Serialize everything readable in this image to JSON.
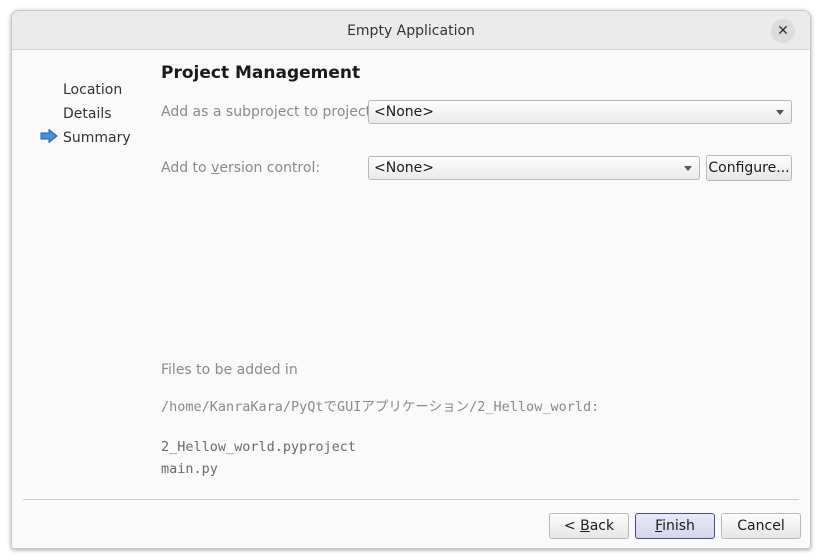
{
  "window": {
    "title": "Empty Application",
    "close_glyph": "✕"
  },
  "steps": [
    {
      "label": "Location",
      "current": false
    },
    {
      "label": "Details",
      "current": false
    },
    {
      "label": "Summary",
      "current": true
    }
  ],
  "page": {
    "title": "Project Management",
    "subproject_label": "Add as a subproject to project:",
    "subproject_value": "<None>",
    "vcs_label_pre": "Add to ",
    "vcs_label_mnemonic": "v",
    "vcs_label_post": "ersion control:",
    "vcs_value": "<None>",
    "configure_label": "Configure...",
    "files_heading": "Files to be added in",
    "files_path": "/home/KanraKara/PyQtでGUIアプリケーション/2_Hellow_world:",
    "files": [
      "2_Hellow_world.pyproject",
      "main.py"
    ]
  },
  "buttons": {
    "back_pre": "< ",
    "back_mnemonic": "B",
    "back_post": "ack",
    "finish_mnemonic": "F",
    "finish_post": "inish",
    "cancel": "Cancel"
  },
  "colors": {
    "current_step_arrow": "#4a90d9",
    "default_button_border": "#4a4a80"
  }
}
